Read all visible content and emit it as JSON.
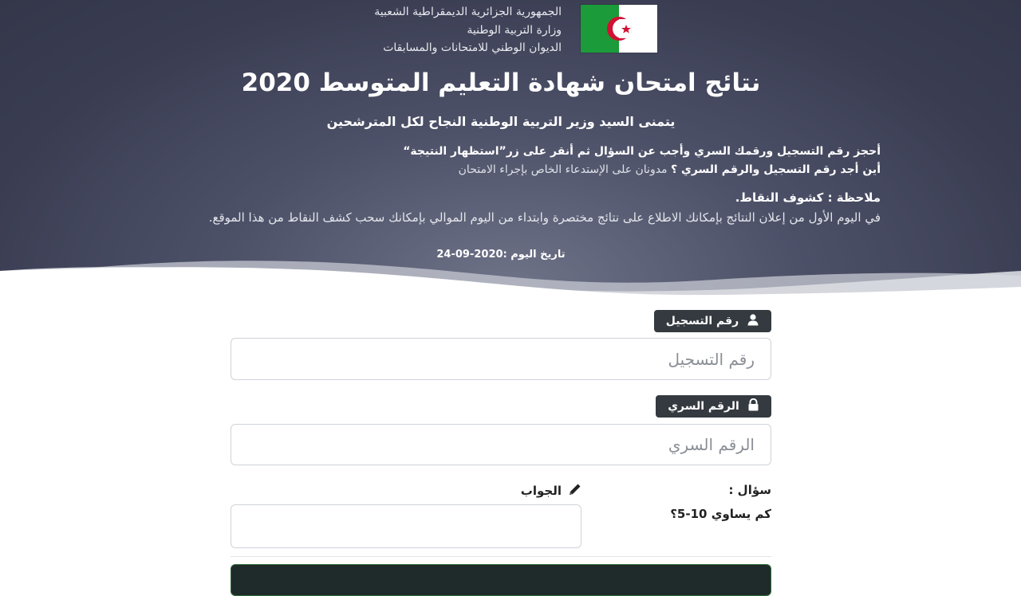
{
  "header": {
    "ministry_lines": [
      "الجمهورية الجزائرية الديمقراطية الشعبية",
      "وزارة التربية الوطنية",
      "الديوان الوطني للامتحانات والمسابقات"
    ],
    "flag_icon": "algeria-flag-icon",
    "title": "نتائج امتحان شهادة التعليم المتوسط 2020",
    "subtitle": "يتمنى السيد وزير التربية الوطنية النجاح لكل المترشحين",
    "instruction_line1": "أحجز رقم التسجيل ورقمك السري وأجب عن السؤال ثم أنقر على زر”استظهار النتيجة“",
    "instruction_line2_bold": "أين أجد رقم التسجيل والرقم السري ؟",
    "instruction_line2_light": " مدونان على الإستدعاء الخاص بإجراء الامتحان",
    "note_title": "ملاحظة : كشوف النقاط.",
    "note_text": "في اليوم الأول من إعلان النتائج بإمكانك الاطلاع على نتائج مختصرة وابتداء من اليوم الموالي بإمكانك سحب كشف النقاط من هذا الموقع.",
    "date_label": "تاريخ اليوم :",
    "date_value": "2020-09-24"
  },
  "form": {
    "registration": {
      "label": "رقم التسجيل",
      "icon": "user-icon",
      "placeholder": "رقم التسجيل",
      "value": ""
    },
    "secret": {
      "label": "الرقم السري",
      "icon": "lock-icon",
      "placeholder": "الرقم السري",
      "value": ""
    },
    "question": {
      "label": "سؤال :",
      "text": "كم يساوي 10-5؟"
    },
    "answer": {
      "label": "الجواب",
      "icon": "pencil-icon",
      "value": ""
    }
  },
  "colors": {
    "hero_dark": "#34374a",
    "badge": "#343a40",
    "flag_green": "#1b9b3a",
    "flag_red": "#d21034"
  }
}
